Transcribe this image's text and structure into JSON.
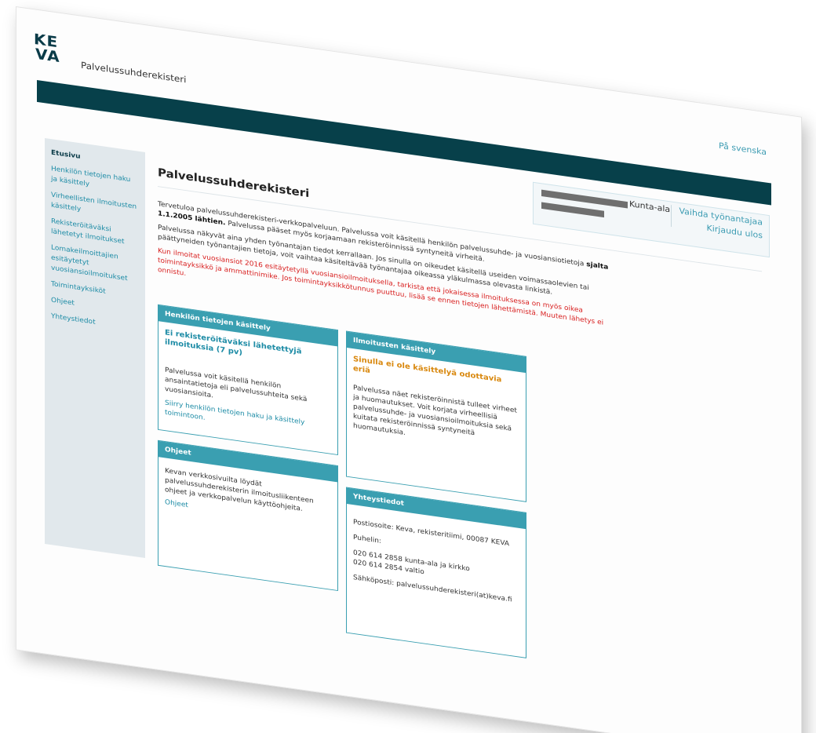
{
  "header": {
    "logo_top": "KE",
    "logo_bottom": "VA",
    "site_name": "Palvelussuhderekisteri",
    "language_link": "På svenska"
  },
  "user": {
    "organization": "Kunta-ala",
    "switch_employer": "Vaihda työnantajaa",
    "logout": "Kirjaudu ulos"
  },
  "sidebar": {
    "items": [
      {
        "label": "Etusivu"
      },
      {
        "label": "Henkilön tietojen haku ja käsittely"
      },
      {
        "label": "Virheellisten ilmoitusten käsittely"
      },
      {
        "label": "Rekisteröitäväksi lähetetyt ilmoitukset"
      },
      {
        "label": "Lomakeilmoittajien esitäytetyt vuosiansioilmoitukset"
      },
      {
        "label": "Toimintayksiköt"
      },
      {
        "label": "Ohjeet"
      },
      {
        "label": "Yhteystiedot"
      }
    ]
  },
  "main": {
    "title": "Palvelussuhderekisteri",
    "p1_a": "Tervetuloa palvelussuhderekisteri-verkkopalveluun. Palvelussa voit käsitellä henkilön palvelussuhde- ja vuosiansiotietoja",
    "p1_bold": "sjalta 1.1.2005 lähtien.",
    "p1_b": "Palvelussa pääset myös korjaamaan rekisteröinnissä syntyneitä virheitä.",
    "p2": "Palvelussa näkyvät aina yhden työnantajan tiedot kerrallaan. Jos sinulla on oikeudet käsitellä useiden voimassaolevien tai päättyneiden työnantajien tietoja, voit vaihtaa käsiteltävää työnantajaa oikeassa yläkulmassa olevasta linkistä.",
    "p3": "Kun ilmoitat vuosiansiot 2016 esitäytetyllä vuosiansioilmoituksella, tarkista että jokaisessa ilmoituksessa on myös oikea toimintayksikkö ja ammattinimike. Jos toimintayksikkötunnus puuttuu, lisää se ennen tietojen lähettämistä. Muuten lähetys ei onnistu."
  },
  "cards": {
    "person": {
      "title": "Henkilön tietojen käsittely",
      "highlight": "Ei rekisteröitäväksi lähetettyjä ilmoituksia (7 pv)",
      "text": "Palvelussa voit käsitellä henkilön ansaintatietoja eli palvelussuhteita sekä vuosiansioita.",
      "link": "Siirry henkilön tietojen haku ja käsittely toimintoon."
    },
    "notices": {
      "title": "Ilmoitusten käsittely",
      "highlight": "Sinulla ei ole käsittelyä odottavia eriä",
      "text": "Palvelussa näet rekisteröinnistä tulleet virheet ja huomautukset. Voit korjata virheellisiä palvelussuhde- ja vuosiansioilmoituksia sekä kuitata rekisteröinnissä syntyneitä huomautuksia."
    },
    "guides": {
      "title": "Ohjeet",
      "text": "Kevan verkkosivuilta löydät palvelussuhderekisterin ilmoitusliikenteen ohjeet ja verkkopalvelun käyttöohjeita.",
      "link": "Ohjeet"
    },
    "contact": {
      "title": "Yhteystiedot",
      "address": "Postiosoite: Keva, rekisteritiimi, 00087 KEVA",
      "phone_label": "Puhelin:",
      "phone1": "020 614 2858 kunta-ala ja kirkko",
      "phone2": "020 614 2854 valtio",
      "email": "Sähköposti: palvelussuhderekisteri(at)keva.fi"
    }
  }
}
